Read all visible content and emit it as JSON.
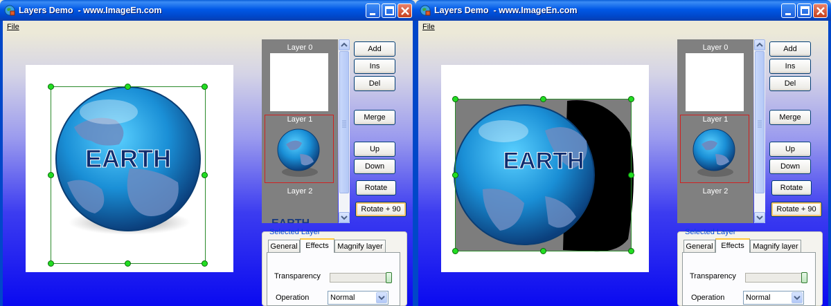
{
  "windows": [
    {
      "title": "Layers Demo  - www.ImageEn.com",
      "menu": [
        "File"
      ],
      "layers": [
        "Layer 0",
        "Layer 1",
        "Layer 2"
      ],
      "buttons": {
        "add": "Add",
        "ins": "Ins",
        "del": "Del",
        "merge": "Merge",
        "up": "Up",
        "down": "Down",
        "rotate": "Rotate",
        "rotate90": "Rotate + 90"
      },
      "selected_layer": {
        "title": "Selected Layer",
        "tabs": [
          "General",
          "Effects",
          "Magnify layer"
        ],
        "active_tab": "Effects",
        "transparency_label": "Transparency",
        "transparency_value": 1.0,
        "operation_label": "Operation",
        "operation_value": "Normal"
      },
      "earth_label": "EARTH"
    },
    {
      "title": "Layers Demo  - www.ImageEn.com",
      "menu": [
        "File"
      ],
      "layers": [
        "Layer 0",
        "Layer 1",
        "Layer 2"
      ],
      "buttons": {
        "add": "Add",
        "ins": "Ins",
        "del": "Del",
        "merge": "Merge",
        "up": "Up",
        "down": "Down",
        "rotate": "Rotate",
        "rotate90": "Rotate + 90"
      },
      "selected_layer": {
        "title": "Selected Layer",
        "tabs": [
          "General",
          "Effects",
          "Magnify layer"
        ],
        "active_tab": "Effects",
        "transparency_label": "Transparency",
        "transparency_value": 1.0,
        "operation_label": "Operation",
        "operation_value": "Normal"
      },
      "earth_label": "EARTH"
    }
  ],
  "colors": {
    "titlebar": "#0058e6",
    "selection": "#22dd22",
    "accent_group": "#0046d5"
  }
}
